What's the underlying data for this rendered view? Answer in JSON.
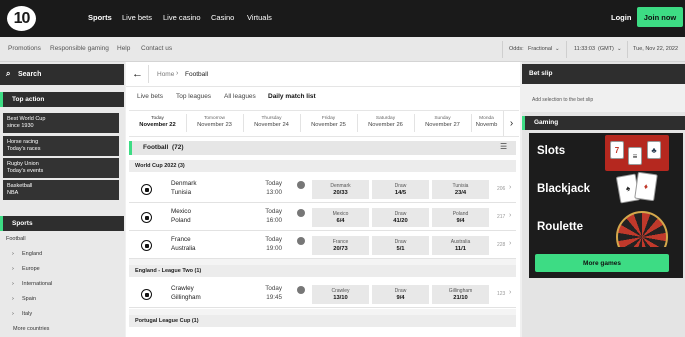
{
  "header": {
    "logo": "10",
    "nav": [
      "Sports",
      "Live bets",
      "Live casino",
      "Casino",
      "Virtuals"
    ],
    "login": "Login",
    "join": "Join now"
  },
  "subheader": {
    "links": [
      "Promotions",
      "Responsible gaming",
      "Help",
      "Contact us"
    ],
    "odds_label": "Odds:",
    "odds_value": "Fractional",
    "time": "11:33:03",
    "tz": "(GMT)",
    "date": "Tue, Nov 22, 2022"
  },
  "sidebar": {
    "search": "Search",
    "top_action_title": "Top action",
    "top_action": [
      {
        "line1": "Best World Cup",
        "line2": "since 1930"
      },
      {
        "line1": "Horse racing",
        "line2": "Today's races"
      },
      {
        "line1": "Rugby Union",
        "line2": "Today's events"
      },
      {
        "line1": "Basketball",
        "line2": "NBA"
      }
    ],
    "sports_title": "Sports",
    "football": "Football",
    "countries": [
      "England",
      "Europe",
      "International",
      "Spain",
      "Italy"
    ],
    "more": "More countries"
  },
  "main": {
    "breadcrumb_home": "Home",
    "breadcrumb_current": "Football",
    "tabs": [
      "Live bets",
      "Top leagues",
      "All leagues",
      "Daily match list"
    ],
    "dates": [
      {
        "day": "Today",
        "date": "November 22"
      },
      {
        "day": "Tomorrow",
        "date": "November 23"
      },
      {
        "day": "Thursday",
        "date": "November 24"
      },
      {
        "day": "Friday",
        "date": "November 25"
      },
      {
        "day": "Saturday",
        "date": "November 26"
      },
      {
        "day": "Sunday",
        "date": "November 27"
      },
      {
        "day": "Monda",
        "date": "Novemb"
      }
    ],
    "section_title": "Football",
    "section_count": "(72)",
    "leagues": [
      {
        "name": "World Cup 2022",
        "count": "(3)"
      },
      {
        "name": "England - League Two",
        "count": "(1)"
      },
      {
        "name": "Portugal League Cup",
        "count": "(1)"
      }
    ],
    "matches": [
      {
        "home": "Denmark",
        "away": "Tunisia",
        "day": "Today",
        "time": "13:00",
        "odds": [
          {
            "label": "Denmark",
            "value": "20/33"
          },
          {
            "label": "Draw",
            "value": "14/5"
          },
          {
            "label": "Tunisia",
            "value": "23/4"
          }
        ],
        "more": "206"
      },
      {
        "home": "Mexico",
        "away": "Poland",
        "day": "Today",
        "time": "16:00",
        "odds": [
          {
            "label": "Mexico",
            "value": "6/4"
          },
          {
            "label": "Draw",
            "value": "41/20"
          },
          {
            "label": "Poland",
            "value": "9/4"
          }
        ],
        "more": "217"
      },
      {
        "home": "France",
        "away": "Australia",
        "day": "Today",
        "time": "19:00",
        "odds": [
          {
            "label": "France",
            "value": "20/73"
          },
          {
            "label": "Draw",
            "value": "5/1"
          },
          {
            "label": "Australia",
            "value": "11/1"
          }
        ],
        "more": "228"
      },
      {
        "home": "Crawley",
        "away": "Gillingham",
        "day": "Today",
        "time": "19:45",
        "odds": [
          {
            "label": "Crawley",
            "value": "13/10"
          },
          {
            "label": "Draw",
            "value": "9/4"
          },
          {
            "label": "Gillingham",
            "value": "21/10"
          }
        ],
        "more": "123"
      }
    ]
  },
  "betslip": {
    "title": "Bet slip",
    "empty": "Add selection to the bet slip",
    "gaming_title": "Gaming",
    "games": [
      "Slots",
      "Blackjack",
      "Roulette"
    ],
    "more_games": "More games"
  },
  "colors": {
    "accent": "#3ddc84",
    "dark": "#1a1a1a"
  }
}
